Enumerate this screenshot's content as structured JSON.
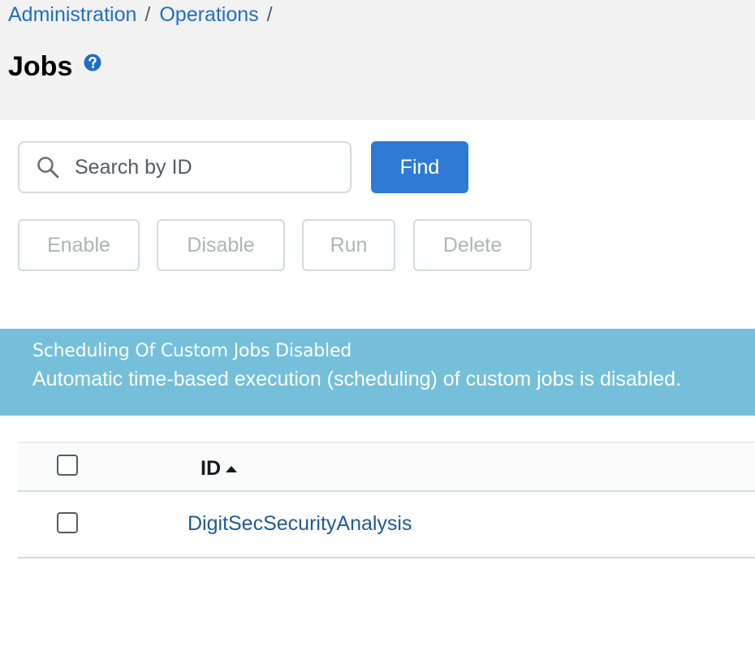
{
  "breadcrumb": {
    "items": [
      {
        "label": "Administration"
      },
      {
        "label": "Operations"
      }
    ],
    "separator": "/"
  },
  "header": {
    "title": "Jobs",
    "help_icon": "question-circle-icon"
  },
  "search": {
    "placeholder": "Search by ID",
    "value": "",
    "icon": "search-icon",
    "find_label": "Find"
  },
  "actions": {
    "enable_label": "Enable",
    "disable_label": "Disable",
    "run_label": "Run",
    "delete_label": "Delete"
  },
  "alert": {
    "title": "Scheduling Of Custom Jobs Disabled",
    "message": "Automatic time-based execution (scheduling) of custom jobs is disabled."
  },
  "table": {
    "columns": [
      {
        "label": "ID",
        "sort": "ascending",
        "sort_icon": "caret-up-icon"
      }
    ],
    "rows": [
      {
        "id": "DigitSecSecurityAnalysis",
        "checked": false
      }
    ]
  },
  "colors": {
    "link": "#1f6fc5",
    "primary_button": "#2d7bd3",
    "alert_background": "#75bfdb",
    "header_background": "#f2f2f2",
    "disabled_text": "#aab7b8"
  }
}
